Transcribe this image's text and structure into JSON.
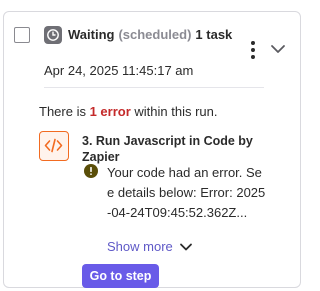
{
  "run": {
    "status_label": "Waiting",
    "status_sub": "(scheduled)",
    "task_count": "1 task",
    "timestamp": "Apr 24, 2025 11:45:17 am"
  },
  "summary": {
    "prefix": "There is ",
    "error_count": "1 error",
    "suffix": " within this run."
  },
  "step": {
    "title": "3. Run Javascript in Code by Zapier",
    "error_message": "Your code had an error. See details below: Error: 2025-04-24T09:45:52.362Z...",
    "show_more_label": "Show more",
    "go_to_step_label": "Go to step",
    "icon": "code-icon"
  },
  "colors": {
    "error_text": "#c42a2a",
    "link": "#5f59c7",
    "button_bg": "#695be8",
    "code_icon": "#f26b21"
  }
}
